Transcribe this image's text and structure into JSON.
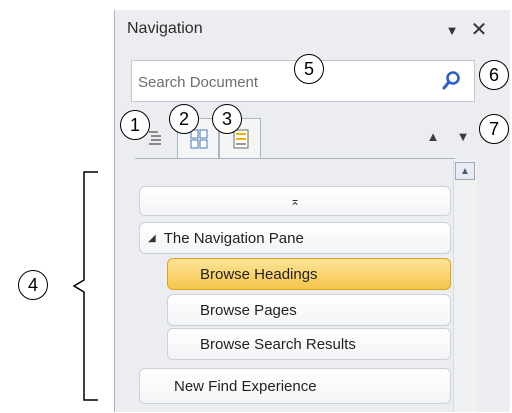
{
  "pane": {
    "title": "Navigation",
    "menu_icon": "dropdown-triangle-icon",
    "close_icon": "close-icon"
  },
  "search": {
    "placeholder": "Search Document",
    "icon": "magnifier-icon",
    "dropdown_icon": "chevron-down-icon"
  },
  "tabs": [
    {
      "name": "headings-tab",
      "icon": "headings-icon"
    },
    {
      "name": "pages-tab",
      "icon": "page-thumbnails-icon"
    },
    {
      "name": "results-tab",
      "icon": "search-results-icon"
    }
  ],
  "nav_arrows": {
    "previous": "▲",
    "next": "▼"
  },
  "headings": {
    "collapse_all_glyph": "⌅",
    "items": [
      {
        "label": "The Navigation Pane",
        "expanded": true
      },
      {
        "label": "Browse Headings",
        "selected": true
      },
      {
        "label": "Browse Pages"
      },
      {
        "label": "Browse Search Results"
      },
      {
        "label": "New Find Experience"
      }
    ]
  },
  "callouts": [
    "1",
    "2",
    "3",
    "4",
    "5",
    "6",
    "7"
  ],
  "colors": {
    "selected_fill": "#f6c64a",
    "selected_border": "#dfa21c",
    "pane_background": "#ecedf0",
    "search_icon": "#2962c4"
  }
}
